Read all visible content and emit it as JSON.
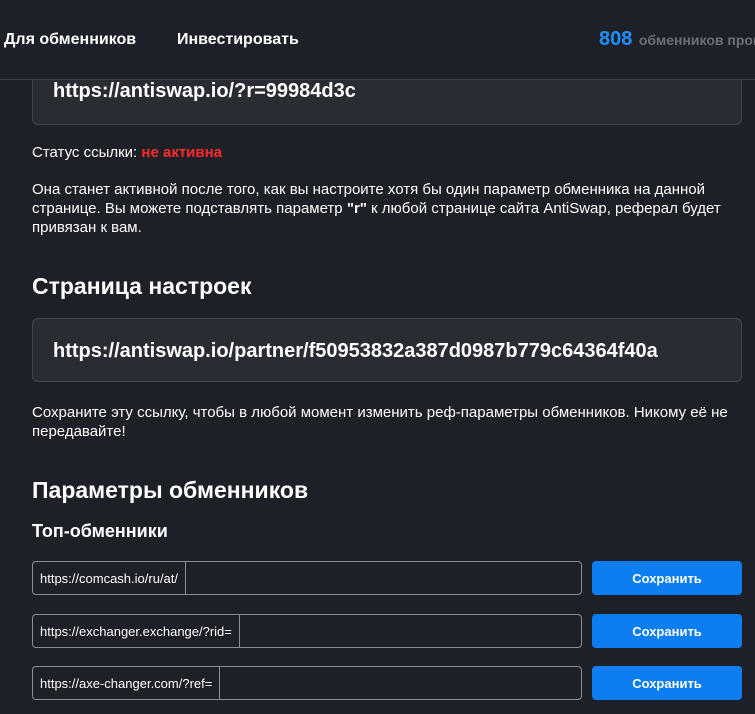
{
  "header": {
    "nav": [
      "Для обменников",
      "Инвестировать"
    ],
    "stats_count": "808",
    "stats_label": "обменников пров"
  },
  "referral": {
    "link": "https://antiswap.io/?r=99984d3c",
    "status_label": "Статус ссылки:",
    "status_value": "не активна",
    "status_color": "#ff2a2a",
    "info_before": "Она станет активной после того, как вы настроите хотя бы один параметр обменника на данной странице. Вы можете подставлять параметр ",
    "info_param": "\"r\"",
    "info_after": " к любой странице сайта AntiSwap, реферал будет привязан к вам."
  },
  "settings": {
    "title": "Страница настроек",
    "link": "https://antiswap.io/partner/f50953832a387d0987b779c64364f40a",
    "note": "Сохраните эту ссылку, чтобы в любой момент изменить реф-параметры обменников. Никому её не передавайте!"
  },
  "exchangers": {
    "title": "Параметры обменников",
    "subtitle": "Топ-обменники",
    "accent": "#0d7ef0",
    "rows": [
      {
        "prefix": "https://comcash.io/ru/at/",
        "value": "",
        "button": "Сохранить"
      },
      {
        "prefix": "https://exchanger.exchange/?rid=",
        "value": "",
        "button": "Сохранить"
      },
      {
        "prefix": "https://axe-changer.com/?ref=",
        "value": "",
        "button": "Сохранить"
      }
    ]
  }
}
